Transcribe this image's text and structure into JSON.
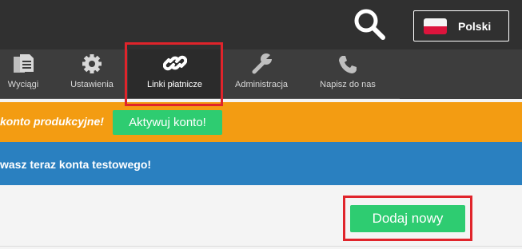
{
  "header": {
    "search_icon": "search-icon",
    "language": {
      "label": "Polski",
      "flag": "poland-flag-icon",
      "flag_colors": [
        "#f5f5f5",
        "#dc143c"
      ]
    }
  },
  "nav": {
    "items": [
      {
        "label": "Wyciągi",
        "icon": "documents-icon"
      },
      {
        "label": "Ustawienia",
        "icon": "gear-icon"
      },
      {
        "label": "Linki płatnicze",
        "icon": "link-icon",
        "active": true
      },
      {
        "label": "Administracja",
        "icon": "wrench-icon"
      },
      {
        "label": "Napisz do nas",
        "icon": "phone-icon"
      }
    ]
  },
  "banners": {
    "production": {
      "message": "konto produkcyjne!",
      "button_label": "Aktywuj konto!",
      "color": "#f39c12"
    },
    "test": {
      "message": "wasz teraz konta testowego!",
      "color": "#2a80c0"
    }
  },
  "main": {
    "add_button_label": "Dodaj nowy"
  },
  "colors": {
    "topbar": "#303030",
    "navbar": "#3d3d3d",
    "accent_green": "#2ecc71",
    "highlight": "#e0242b"
  }
}
